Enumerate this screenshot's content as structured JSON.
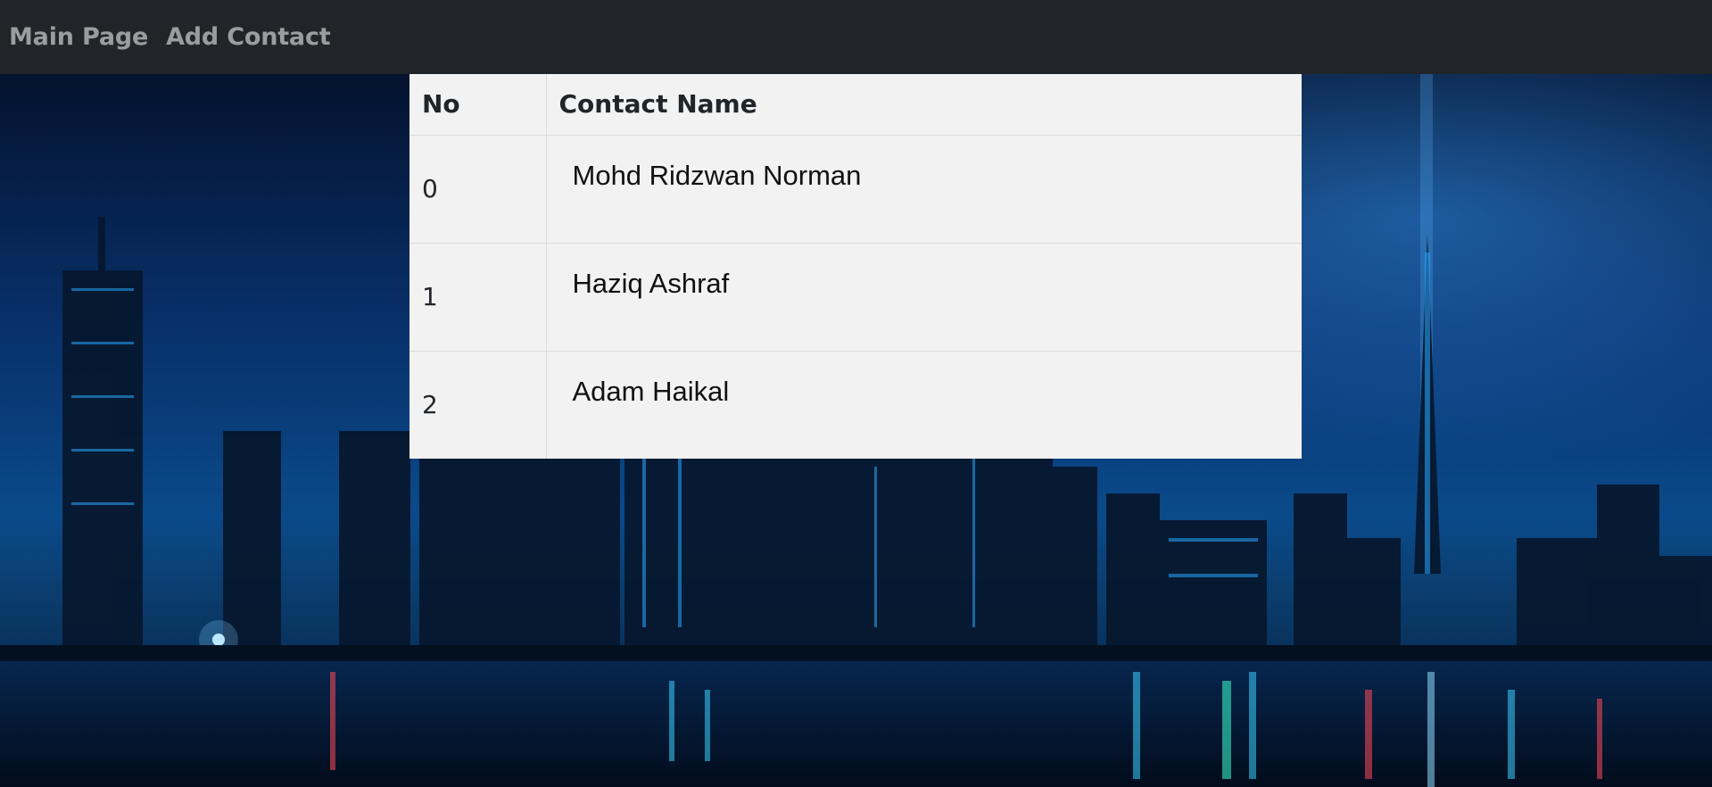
{
  "navbar": {
    "links": [
      {
        "label": "Main Page"
      },
      {
        "label": "Add Contact"
      }
    ]
  },
  "table": {
    "headers": {
      "no": "No",
      "name": "Contact Name"
    },
    "rows": [
      {
        "no": "0",
        "name": "Mohd Ridzwan Norman"
      },
      {
        "no": "1",
        "name": "Haziq Ashraf"
      },
      {
        "no": "2",
        "name": "Adam Haikal"
      }
    ]
  },
  "colors": {
    "navbar_bg": "#212529",
    "table_bg": "#f2f2f2",
    "sky": "#082a5c",
    "water": "#041630"
  },
  "background": {
    "subject": "night-city-skyline"
  }
}
